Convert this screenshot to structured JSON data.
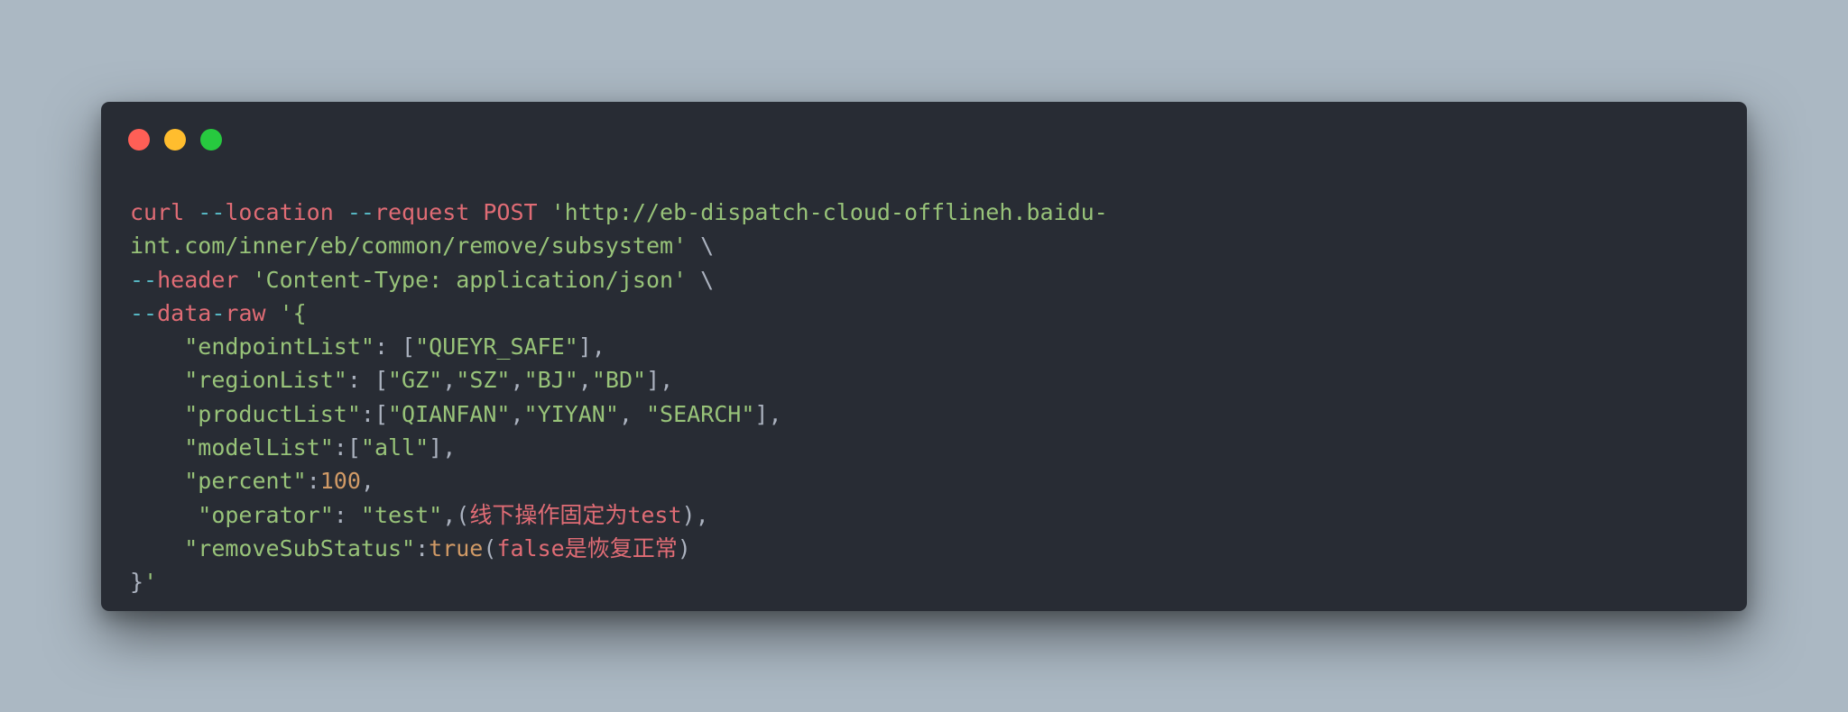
{
  "window": {
    "controls": [
      "close",
      "minimize",
      "maximize"
    ],
    "colors": {
      "close": "#ff5f56",
      "minimize": "#ffbd2e",
      "maximize": "#27c93f",
      "background": "#282c34",
      "page_background": "#abb8c3"
    }
  },
  "code": {
    "lines": [
      {
        "tokens": [
          {
            "text": "curl ",
            "type": "kw"
          },
          {
            "text": "--",
            "type": "op"
          },
          {
            "text": "location ",
            "type": "kw"
          },
          {
            "text": "--",
            "type": "op"
          },
          {
            "text": "request POST ",
            "type": "kw"
          },
          {
            "text": "'http://eb-dispatch-cloud-offlineh.baidu-",
            "type": "str"
          }
        ]
      },
      {
        "tokens": [
          {
            "text": "int.com/inner/eb/common/remove/subsystem' ",
            "type": "str"
          },
          {
            "text": "\\",
            "type": "plain"
          }
        ]
      },
      {
        "tokens": [
          {
            "text": "--",
            "type": "op"
          },
          {
            "text": "header ",
            "type": "kw"
          },
          {
            "text": "'Content-Type: application/json' ",
            "type": "str"
          },
          {
            "text": "\\",
            "type": "plain"
          }
        ]
      },
      {
        "tokens": [
          {
            "text": "--",
            "type": "op"
          },
          {
            "text": "data",
            "type": "kw"
          },
          {
            "text": "-",
            "type": "op"
          },
          {
            "text": "raw ",
            "type": "kw"
          },
          {
            "text": "'{",
            "type": "str"
          }
        ]
      },
      {
        "tokens": [
          {
            "text": "    ",
            "type": "plain"
          },
          {
            "text": "\"endpointList\"",
            "type": "str"
          },
          {
            "text": ": [",
            "type": "plain"
          },
          {
            "text": "\"QUEYR_SAFE\"",
            "type": "str"
          },
          {
            "text": "],",
            "type": "plain"
          }
        ]
      },
      {
        "tokens": [
          {
            "text": "    ",
            "type": "plain"
          },
          {
            "text": "\"regionList\"",
            "type": "str"
          },
          {
            "text": ": [",
            "type": "plain"
          },
          {
            "text": "\"GZ\"",
            "type": "str"
          },
          {
            "text": ",",
            "type": "plain"
          },
          {
            "text": "\"SZ\"",
            "type": "str"
          },
          {
            "text": ",",
            "type": "plain"
          },
          {
            "text": "\"BJ\"",
            "type": "str"
          },
          {
            "text": ",",
            "type": "plain"
          },
          {
            "text": "\"BD\"",
            "type": "str"
          },
          {
            "text": "],",
            "type": "plain"
          }
        ]
      },
      {
        "tokens": [
          {
            "text": "    ",
            "type": "plain"
          },
          {
            "text": "\"productList\"",
            "type": "str"
          },
          {
            "text": ":[",
            "type": "plain"
          },
          {
            "text": "\"QIANFAN\"",
            "type": "str"
          },
          {
            "text": ",",
            "type": "plain"
          },
          {
            "text": "\"YIYAN\"",
            "type": "str"
          },
          {
            "text": ", ",
            "type": "plain"
          },
          {
            "text": "\"SEARCH\"",
            "type": "str"
          },
          {
            "text": "],",
            "type": "plain"
          }
        ]
      },
      {
        "tokens": [
          {
            "text": "    ",
            "type": "plain"
          },
          {
            "text": "\"modelList\"",
            "type": "str"
          },
          {
            "text": ":[",
            "type": "plain"
          },
          {
            "text": "\"all\"",
            "type": "str"
          },
          {
            "text": "],",
            "type": "plain"
          }
        ]
      },
      {
        "tokens": [
          {
            "text": "    ",
            "type": "plain"
          },
          {
            "text": "\"percent\"",
            "type": "str"
          },
          {
            "text": ":",
            "type": "plain"
          },
          {
            "text": "100",
            "type": "num"
          },
          {
            "text": ",",
            "type": "plain"
          }
        ]
      },
      {
        "tokens": [
          {
            "text": "     ",
            "type": "plain"
          },
          {
            "text": "\"operator\"",
            "type": "str"
          },
          {
            "text": ": ",
            "type": "plain"
          },
          {
            "text": "\"test\"",
            "type": "str"
          },
          {
            "text": ",(",
            "type": "plain"
          },
          {
            "text": "线下操作固定为test",
            "type": "kw"
          },
          {
            "text": "),",
            "type": "plain"
          }
        ]
      },
      {
        "tokens": [
          {
            "text": "    ",
            "type": "plain"
          },
          {
            "text": "\"removeSubStatus\"",
            "type": "str"
          },
          {
            "text": ":",
            "type": "plain"
          },
          {
            "text": "true",
            "type": "num"
          },
          {
            "text": "(",
            "type": "plain"
          },
          {
            "text": "false是恢复正常",
            "type": "kw"
          },
          {
            "text": ")",
            "type": "plain"
          }
        ]
      },
      {
        "tokens": [
          {
            "text": "}",
            "type": "plain"
          },
          {
            "text": "'",
            "type": "str"
          }
        ]
      }
    ]
  }
}
